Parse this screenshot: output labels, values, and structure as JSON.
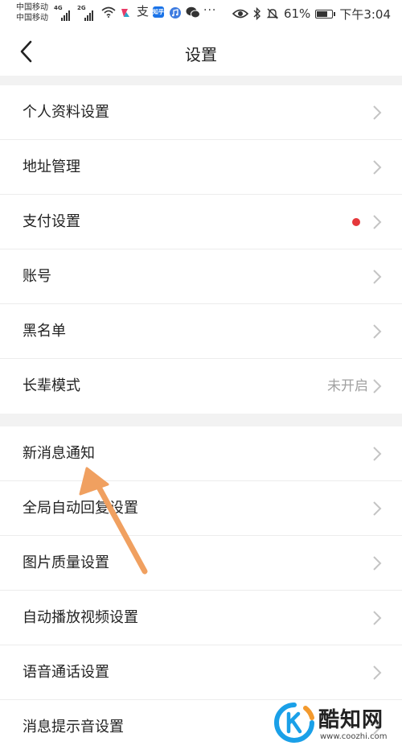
{
  "status_bar": {
    "carrier_1": "中国移动",
    "carrier_2": "中国移动",
    "network_1": "4G",
    "network_2": "2G",
    "battery": "61%",
    "time": "下午3:04",
    "icons": [
      "wifi-icon",
      "app-icon",
      "alipay-icon",
      "zhihu-icon",
      "music-icon",
      "wechat-icon",
      "more-icon",
      "eye-icon",
      "bluetooth-icon",
      "mute-icon",
      "battery-icon"
    ],
    "more": "···"
  },
  "nav": {
    "title": "设置",
    "back_icon": "chevron-left-icon"
  },
  "section_1": {
    "items": [
      {
        "label": "个人资料设置"
      },
      {
        "label": "地址管理"
      },
      {
        "label": "支付设置",
        "has_red_dot": true
      },
      {
        "label": "账号"
      },
      {
        "label": "黑名单"
      },
      {
        "label": "长辈模式",
        "value": "未开启"
      }
    ]
  },
  "section_2": {
    "items": [
      {
        "label": "新消息通知"
      },
      {
        "label": "全局自动回复设置"
      },
      {
        "label": "图片质量设置"
      },
      {
        "label": "自动播放视频设置"
      },
      {
        "label": "语音通话设置"
      },
      {
        "label": "消息提示音设置"
      }
    ]
  },
  "watermark": {
    "name": "酷知网",
    "url": "www.coozhi.com"
  },
  "colors": {
    "red_dot": "#e5383b",
    "arrow": "#f0a060",
    "gap_bg": "#f2f2f2",
    "chevron": "#c4c4c4"
  }
}
